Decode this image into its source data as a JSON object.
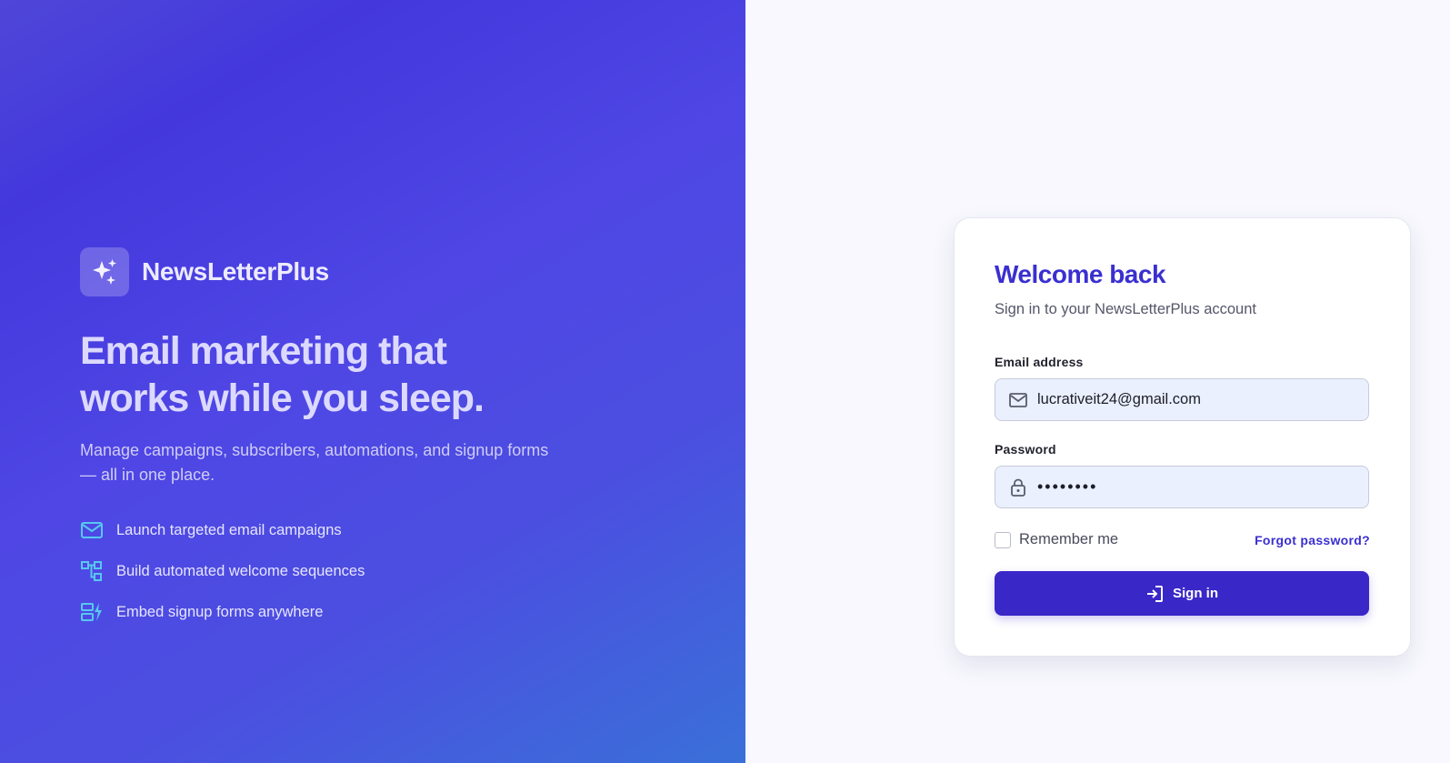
{
  "brand": {
    "name": "NewsLetterPlus",
    "icon": "sparkles-icon"
  },
  "hero": {
    "headline_line1": "Email marketing that",
    "headline_line2": "works while you sleep.",
    "subtext": "Manage campaigns, subscribers, automations, and signup forms — all in one place."
  },
  "features": [
    {
      "icon": "mail-icon",
      "label": "Launch targeted email campaigns"
    },
    {
      "icon": "workflow-icon",
      "label": "Build automated welcome sequences"
    },
    {
      "icon": "form-bolt-icon",
      "label": "Embed signup forms anywhere"
    }
  ],
  "login": {
    "title": "Welcome back",
    "subtitle": "Sign in to your NewsLetterPlus account",
    "email_label": "Email address",
    "email_value": "lucrativeit24@gmail.com",
    "password_label": "Password",
    "password_value": "••••••••",
    "remember_label": "Remember me",
    "remember_checked": false,
    "forgot_label": "Forgot password?",
    "signin_label": "Sign in"
  },
  "colors": {
    "accent": "#3a27c8",
    "title": "#3a2fd0",
    "feature_icon": "#57c8f0",
    "gradient_start": "#4338dc",
    "gradient_end": "#3a70d8"
  }
}
